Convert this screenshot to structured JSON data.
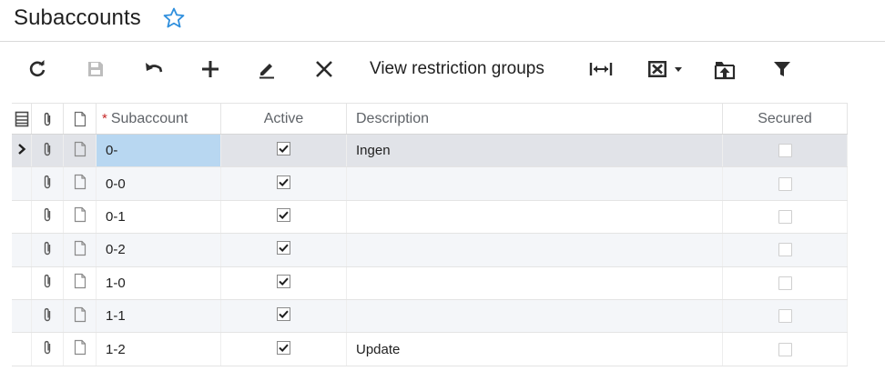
{
  "page": {
    "title": "Subaccounts",
    "favorite_icon": "star-outline-icon",
    "accent_color": "#2f8fdd"
  },
  "toolbar": {
    "buttons": [
      {
        "name": "refresh",
        "icon": "refresh-icon",
        "enabled": true
      },
      {
        "name": "save",
        "icon": "save-icon",
        "enabled": false
      },
      {
        "name": "undo",
        "icon": "undo-icon",
        "enabled": true
      },
      {
        "name": "add",
        "icon": "plus-icon",
        "enabled": true
      },
      {
        "name": "edit",
        "icon": "pencil-icon",
        "enabled": true
      },
      {
        "name": "delete",
        "icon": "close-icon",
        "enabled": true
      }
    ],
    "view_restriction_groups_label": "View restriction groups",
    "fit_columns_icon": "fit-columns-icon",
    "export_icon": "excel-export-icon",
    "upload_icon": "upload-icon",
    "filter_icon": "filter-icon"
  },
  "grid": {
    "columns": {
      "subaccount": "Subaccount",
      "active": "Active",
      "description": "Description",
      "secured": "Secured"
    },
    "rows": [
      {
        "subaccount": "0-",
        "active": true,
        "description": "Ingen",
        "secured": false
      },
      {
        "subaccount": "0-0",
        "active": true,
        "description": "",
        "secured": false
      },
      {
        "subaccount": "0-1",
        "active": true,
        "description": "",
        "secured": false
      },
      {
        "subaccount": "0-2",
        "active": true,
        "description": "",
        "secured": false
      },
      {
        "subaccount": "1-0",
        "active": true,
        "description": "",
        "secured": false
      },
      {
        "subaccount": "1-1",
        "active": true,
        "description": "",
        "secured": false
      },
      {
        "subaccount": "1-2",
        "active": true,
        "description": "Update",
        "secured": false
      }
    ]
  }
}
